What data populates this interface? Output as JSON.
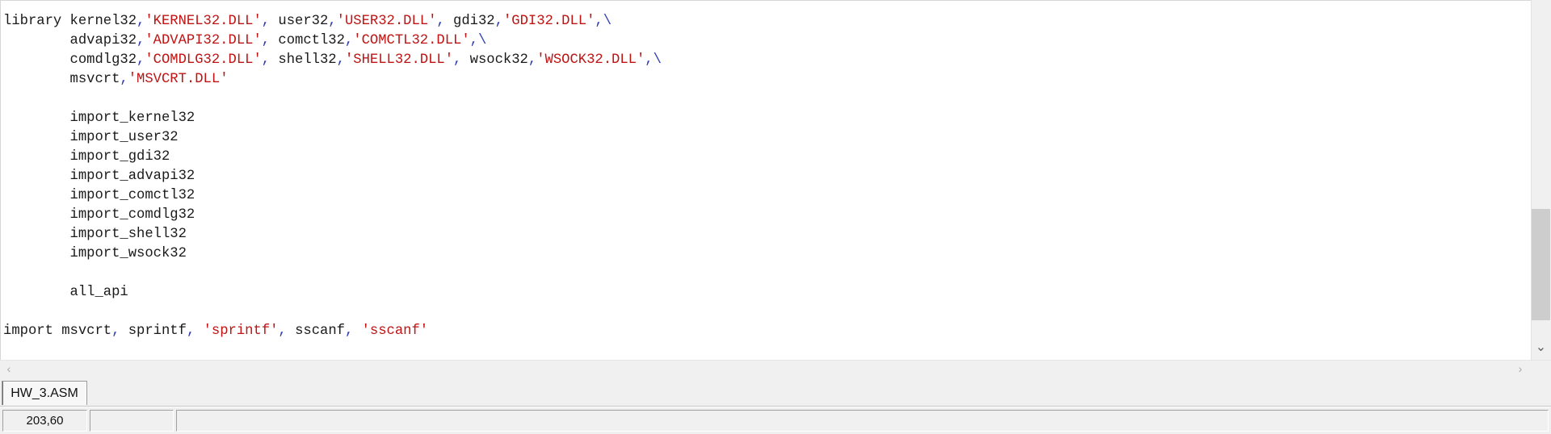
{
  "editor": {
    "lines": [
      [
        [
          "t",
          "library kernel32"
        ],
        [
          "o",
          ","
        ],
        [
          "s",
          "'KERNEL32.DLL'"
        ],
        [
          "o",
          ","
        ],
        [
          "t",
          " user32"
        ],
        [
          "o",
          ","
        ],
        [
          "s",
          "'USER32.DLL'"
        ],
        [
          "o",
          ","
        ],
        [
          "t",
          " gdi32"
        ],
        [
          "o",
          ","
        ],
        [
          "s",
          "'GDI32.DLL'"
        ],
        [
          "o",
          ",\\"
        ]
      ],
      [
        [
          "t",
          "        advapi32"
        ],
        [
          "o",
          ","
        ],
        [
          "s",
          "'ADVAPI32.DLL'"
        ],
        [
          "o",
          ","
        ],
        [
          "t",
          " comctl32"
        ],
        [
          "o",
          ","
        ],
        [
          "s",
          "'COMCTL32.DLL'"
        ],
        [
          "o",
          ",\\"
        ]
      ],
      [
        [
          "t",
          "        comdlg32"
        ],
        [
          "o",
          ","
        ],
        [
          "s",
          "'COMDLG32.DLL'"
        ],
        [
          "o",
          ","
        ],
        [
          "t",
          " shell32"
        ],
        [
          "o",
          ","
        ],
        [
          "s",
          "'SHELL32.DLL'"
        ],
        [
          "o",
          ","
        ],
        [
          "t",
          " wsock32"
        ],
        [
          "o",
          ","
        ],
        [
          "s",
          "'WSOCK32.DLL'"
        ],
        [
          "o",
          ",\\"
        ]
      ],
      [
        [
          "t",
          "        msvcrt"
        ],
        [
          "o",
          ","
        ],
        [
          "s",
          "'MSVCRT.DLL'"
        ]
      ],
      [],
      [
        [
          "t",
          "        import_kernel32"
        ]
      ],
      [
        [
          "t",
          "        import_user32"
        ]
      ],
      [
        [
          "t",
          "        import_gdi32"
        ]
      ],
      [
        [
          "t",
          "        import_advapi32"
        ]
      ],
      [
        [
          "t",
          "        import_comctl32"
        ]
      ],
      [
        [
          "t",
          "        import_comdlg32"
        ]
      ],
      [
        [
          "t",
          "        import_shell32"
        ]
      ],
      [
        [
          "t",
          "        import_wsock32"
        ]
      ],
      [],
      [
        [
          "t",
          "        all_api"
        ]
      ],
      [],
      [
        [
          "t",
          "import msvcrt"
        ],
        [
          "o",
          ","
        ],
        [
          "t",
          " sprintf"
        ],
        [
          "o",
          ","
        ],
        [
          "t",
          " "
        ],
        [
          "s",
          "'sprintf'"
        ],
        [
          "o",
          ","
        ],
        [
          "t",
          " sscanf"
        ],
        [
          "o",
          ","
        ],
        [
          "t",
          " "
        ],
        [
          "s",
          "'sscanf'"
        ]
      ]
    ]
  },
  "tabs": [
    {
      "label": "HW_3.ASM",
      "active": true
    }
  ],
  "status": {
    "position": "203,60",
    "cell2": "",
    "cell3": ""
  },
  "icons": {
    "scroll_down": "chevron-down-icon",
    "scroll_left": "chevron-left-icon",
    "scroll_right": "chevron-right-icon"
  },
  "colors": {
    "string": "#c01414",
    "operator": "#2f3fb0",
    "text": "#1a1a1a"
  }
}
